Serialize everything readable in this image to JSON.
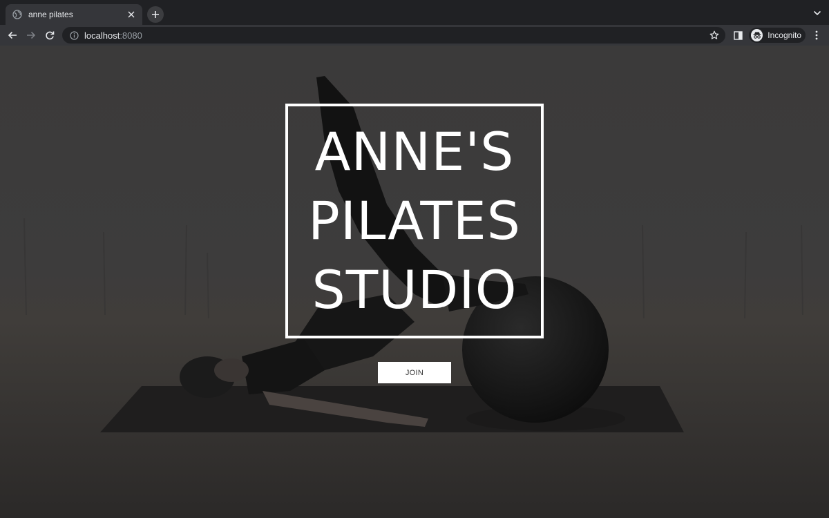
{
  "browser": {
    "tab": {
      "title": "anne pilates"
    },
    "address": {
      "host": "localhost",
      "port": ":8080"
    },
    "profile": {
      "label": "Incognito"
    }
  },
  "page": {
    "hero": {
      "logo_lines": [
        "ANNE'S",
        "PILATES",
        "STUDIO"
      ],
      "join_label": "JOIN"
    }
  },
  "icons": {
    "tab_favicon": "globe-icon",
    "tab_close": "close-icon",
    "new_tab": "plus-icon",
    "tab_search": "chevron-down-icon",
    "back": "arrow-left-icon",
    "forward": "arrow-right-icon",
    "reload": "reload-icon",
    "site_info": "info-icon",
    "bookmark": "star-icon",
    "side_panel": "side-panel-icon",
    "incognito": "incognito-icon",
    "menu": "kebab-menu-icon"
  }
}
